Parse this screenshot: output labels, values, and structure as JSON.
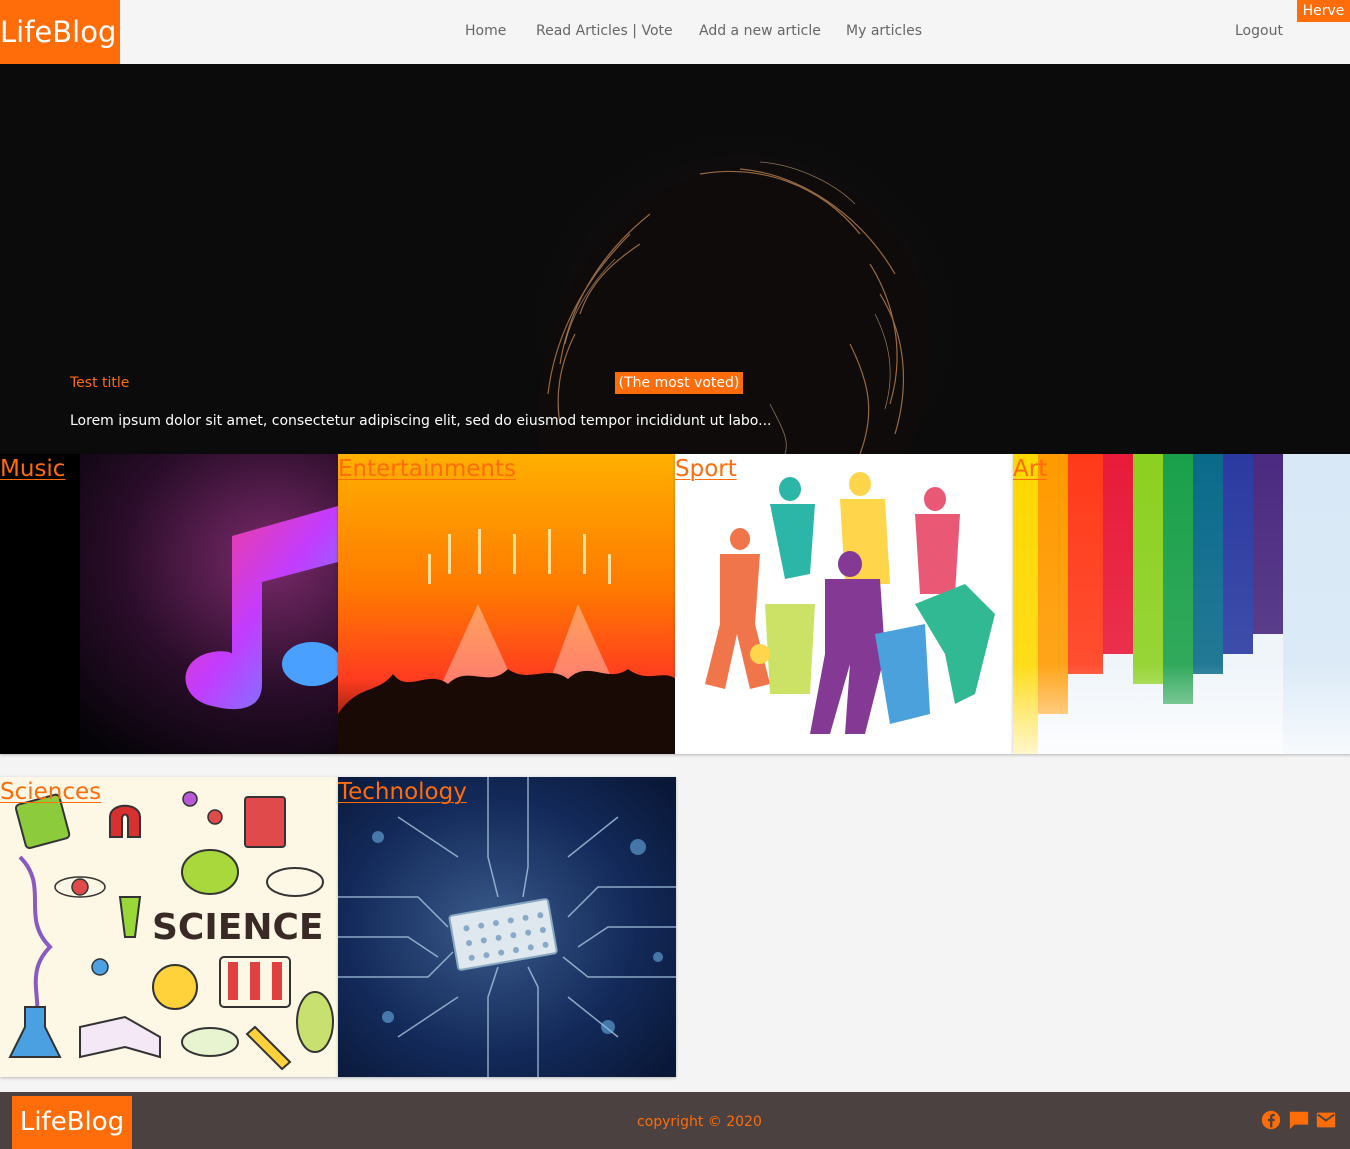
{
  "header": {
    "brand": "LifeBlog",
    "nav": [
      {
        "label": "Home"
      },
      {
        "label": "Read Articles | Vote"
      },
      {
        "label": "Add a new article"
      },
      {
        "label": "My articles"
      }
    ],
    "logout": "Logout",
    "user": "Herve"
  },
  "hero": {
    "title": "Test title",
    "badge": "(The most voted)",
    "excerpt": "Lorem ipsum dolor sit amet, consectetur adipiscing elit, sed do eiusmod tempor incididunt ut labo..."
  },
  "categories": [
    {
      "label": "Music"
    },
    {
      "label": "Entertainments"
    },
    {
      "label": "Sport"
    },
    {
      "label": "Art"
    },
    {
      "label": "Sciences"
    },
    {
      "label": "Technology"
    }
  ],
  "science_word": "SCIENCE",
  "footer": {
    "brand": "LifeBlog",
    "copyright": "copyright © 2020",
    "icons": [
      "facebook-icon",
      "chat-icon",
      "mail-icon"
    ]
  },
  "colors": {
    "accent": "#ff6c0a",
    "footer_bg": "#4a4140",
    "header_bg": "#f5f5f5"
  }
}
